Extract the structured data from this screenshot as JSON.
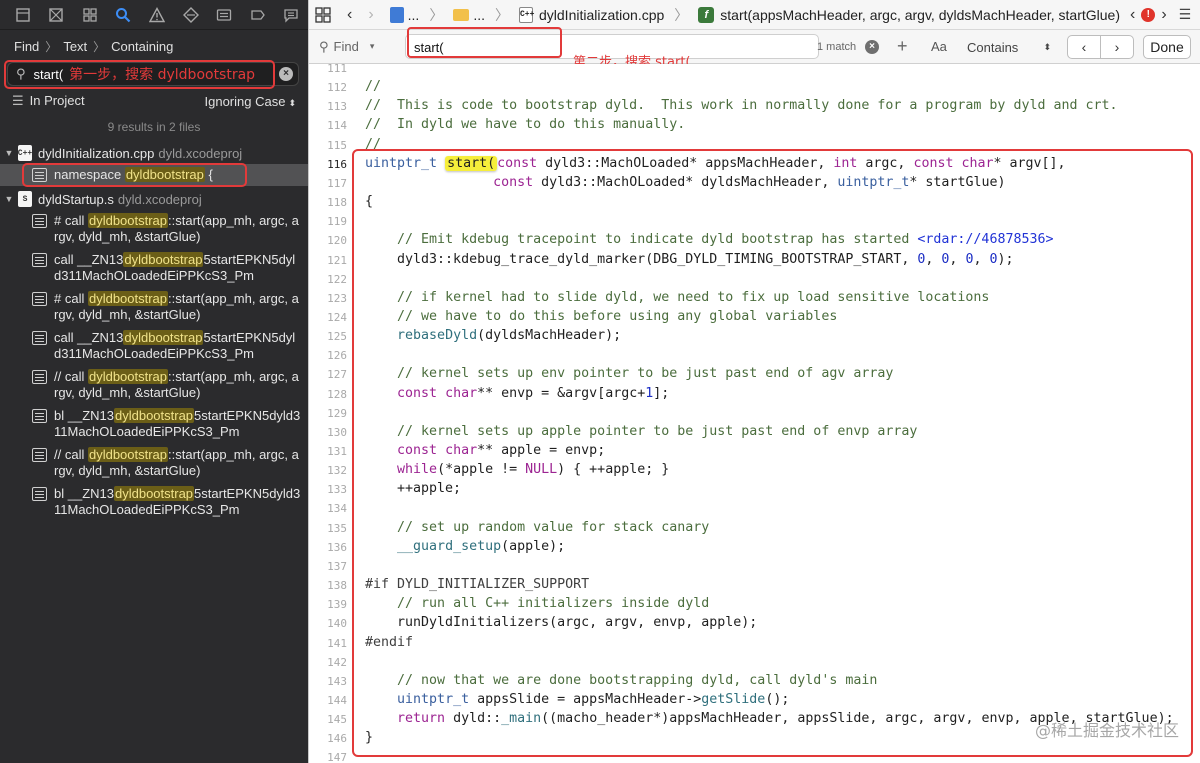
{
  "navigator": {
    "find_path": {
      "find": "Find",
      "text": "Text",
      "containing": "Containing"
    },
    "search": {
      "value": "start(",
      "annotation": "第一步，搜索 dyldbootstrap"
    },
    "scope": {
      "in_project": "In Project",
      "ignoring_case": "Ignoring Case"
    },
    "results_count": "9 results in 2 files",
    "files": [
      {
        "icon": "C++",
        "name": "dyldInitialization.cpp",
        "project": "dyld.xcodeproj"
      },
      {
        "icon": "S",
        "name": "dyldStartup.s",
        "project": "dyld.xcodeproj"
      }
    ],
    "results": [
      {
        "pre": "namespace ",
        "hl": "dyldbootstrap",
        "post": " {"
      },
      {
        "pre": "# call ",
        "hl": "dyldbootstrap",
        "post": "::start(app_mh, argc, argv, dyld_mh, &startGlue)"
      },
      {
        "pre": "call    __ZN13",
        "hl": "dyldbootstrap",
        "post": "5startEPKN5dyld311MachOLoadedEiPPKcS3_Pm"
      },
      {
        "pre": "# call ",
        "hl": "dyldbootstrap",
        "post": "::start(app_mh, argc, argv, dyld_mh, &startGlue)"
      },
      {
        "pre": "call    __ZN13",
        "hl": "dyldbootstrap",
        "post": "5startEPKN5dyld311MachOLoadedEiPPKcS3_Pm"
      },
      {
        "pre": "// call ",
        "hl": "dyldbootstrap",
        "post": "::start(app_mh, argc, argv, dyld_mh, &startGlue)"
      },
      {
        "pre": "bl      __ZN13",
        "hl": "dyldbootstrap",
        "post": "5startEPKN5dyld311MachOLoadedEiPPKcS3_Pm"
      },
      {
        "pre": "// call ",
        "hl": "dyldbootstrap",
        "post": "::start(app_mh, argc, argv, dyld_mh, &startGlue)"
      },
      {
        "pre": "bl      __ZN13",
        "hl": "dyldbootstrap",
        "post": "5startEPKN5dyld311MachOLoadedEiPPKcS3_Pm"
      }
    ]
  },
  "editor": {
    "jump_bar": {
      "ellipsis": "...",
      "file": "dyldInitialization.cpp",
      "function": "start(appsMachHeader, argc, argv, dyldsMachHeader, startGlue)",
      "error_count": "!"
    },
    "findbar": {
      "mode": "Find",
      "query": "start(",
      "annotation": "第二步，搜索 start(",
      "match_count": "1 match",
      "case_label": "Aa",
      "contains": "Contains",
      "done": "Done"
    },
    "current_line": "116",
    "code_lines": [
      {
        "n": "111",
        "t": ""
      },
      {
        "n": "112",
        "t": "//"
      },
      {
        "n": "113",
        "t": "//  This is code to bootstrap dyld.  This work in normally done for a program by dyld and crt."
      },
      {
        "n": "114",
        "t": "//  In dyld we have to do this manually."
      },
      {
        "n": "115",
        "t": "//"
      },
      {
        "n": "116",
        "t": "uintptr_t start(const dyld3::MachOLoaded* appsMachHeader, int argc, const char* argv[],"
      },
      {
        "n": "117",
        "t": "                const dyld3::MachOLoaded* dyldsMachHeader, uintptr_t* startGlue)"
      },
      {
        "n": "118",
        "t": "{"
      },
      {
        "n": "119",
        "t": ""
      },
      {
        "n": "120",
        "t": "    // Emit kdebug tracepoint to indicate dyld bootstrap has started <rdar://46878536>"
      },
      {
        "n": "121",
        "t": "    dyld3::kdebug_trace_dyld_marker(DBG_DYLD_TIMING_BOOTSTRAP_START, 0, 0, 0, 0);"
      },
      {
        "n": "122",
        "t": ""
      },
      {
        "n": "123",
        "t": "    // if kernel had to slide dyld, we need to fix up load sensitive locations"
      },
      {
        "n": "124",
        "t": "    // we have to do this before using any global variables"
      },
      {
        "n": "125",
        "t": "    rebaseDyld(dyldsMachHeader);"
      },
      {
        "n": "126",
        "t": ""
      },
      {
        "n": "127",
        "t": "    // kernel sets up env pointer to be just past end of agv array"
      },
      {
        "n": "128",
        "t": "    const char** envp = &argv[argc+1];"
      },
      {
        "n": "129",
        "t": ""
      },
      {
        "n": "130",
        "t": "    // kernel sets up apple pointer to be just past end of envp array"
      },
      {
        "n": "131",
        "t": "    const char** apple = envp;"
      },
      {
        "n": "132",
        "t": "    while(*apple != NULL) { ++apple; }"
      },
      {
        "n": "133",
        "t": "    ++apple;"
      },
      {
        "n": "134",
        "t": ""
      },
      {
        "n": "135",
        "t": "    // set up random value for stack canary"
      },
      {
        "n": "136",
        "t": "    __guard_setup(apple);"
      },
      {
        "n": "137",
        "t": ""
      },
      {
        "n": "138",
        "t": "#if DYLD_INITIALIZER_SUPPORT"
      },
      {
        "n": "139",
        "t": "    // run all C++ initializers inside dyld"
      },
      {
        "n": "140",
        "t": "    runDyldInitializers(argc, argv, envp, apple);"
      },
      {
        "n": "141",
        "t": "#endif"
      },
      {
        "n": "142",
        "t": ""
      },
      {
        "n": "143",
        "t": "    // now that we are done bootstrapping dyld, call dyld's main"
      },
      {
        "n": "144",
        "t": "    uintptr_t appsSlide = appsMachHeader->getSlide();"
      },
      {
        "n": "145",
        "t": "    return dyld::_main((macho_header*)appsMachHeader, appsSlide, argc, argv, envp, apple, startGlue);"
      },
      {
        "n": "146",
        "t": "}"
      },
      {
        "n": "147",
        "t": ""
      }
    ],
    "watermark": "@稀土掘金技术社区"
  },
  "colors": {
    "annotation_red": "#e23a3a",
    "navigator_bg": "#2b2b2d",
    "accent": "#3d8ef7",
    "find_highlight": "#f6ee3b"
  }
}
